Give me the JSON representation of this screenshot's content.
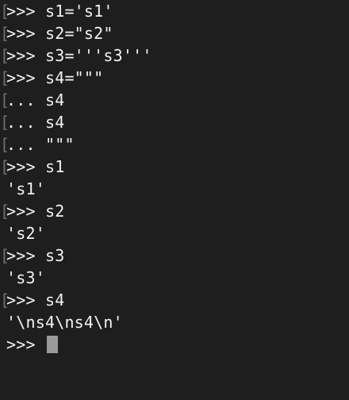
{
  "terminal": {
    "lines": [
      {
        "bracket": "[",
        "text": ">>> s1='s1'"
      },
      {
        "bracket": "[",
        "text": ">>> s2=\"s2\""
      },
      {
        "bracket": "[",
        "text": ">>> s3='''s3'''"
      },
      {
        "bracket": "[",
        "text": ">>> s4=\"\"\""
      },
      {
        "bracket": "[",
        "text": "... s4"
      },
      {
        "bracket": "[",
        "text": "... s4"
      },
      {
        "bracket": "[",
        "text": "... \"\"\""
      },
      {
        "bracket": "[",
        "text": ">>> s1"
      },
      {
        "bracket": "",
        "text": "'s1'"
      },
      {
        "bracket": "[",
        "text": ">>> s2"
      },
      {
        "bracket": "",
        "text": "'s2'"
      },
      {
        "bracket": "[",
        "text": ">>> s3"
      },
      {
        "bracket": "",
        "text": "'s3'"
      },
      {
        "bracket": "[",
        "text": ">>> s4"
      },
      {
        "bracket": "",
        "text": "'\\ns4\\ns4\\n'"
      }
    ],
    "prompt": ">>> "
  }
}
